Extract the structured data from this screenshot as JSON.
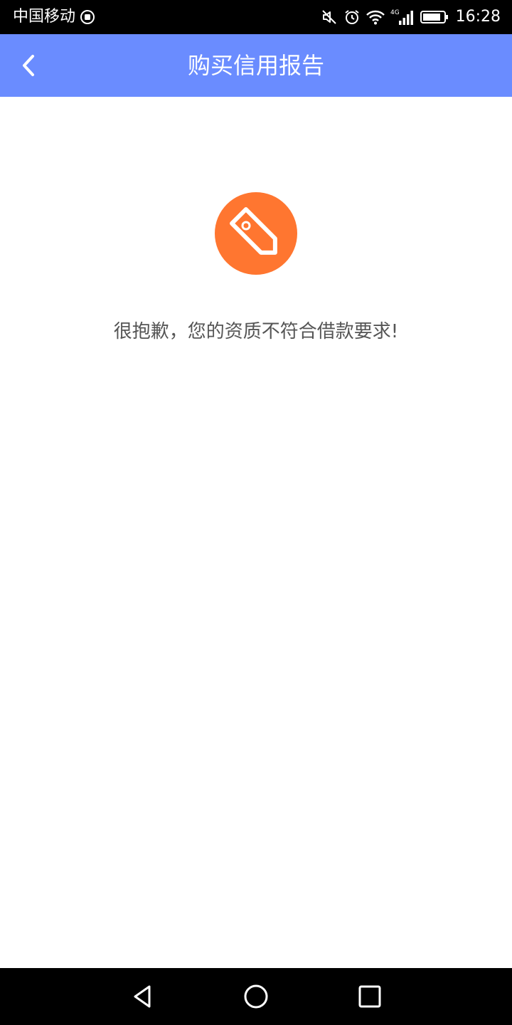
{
  "status_bar": {
    "carrier": "中国移动",
    "time": "16:28",
    "network": "4G",
    "icons": [
      "carrier-shield-icon",
      "mute-icon",
      "alarm-icon",
      "wifi-icon",
      "signal-icon",
      "battery-icon"
    ]
  },
  "header": {
    "title": "购买信用报告",
    "back_icon": "back-chevron-icon",
    "background_color": "#6a8cff"
  },
  "main": {
    "badge_icon": "price-tag-icon",
    "badge_color": "#ff7630",
    "message": "很抱歉，您的资质不符合借款要求!"
  },
  "nav_bar": {
    "icons": [
      "nav-back-icon",
      "nav-home-icon",
      "nav-recents-icon"
    ]
  }
}
